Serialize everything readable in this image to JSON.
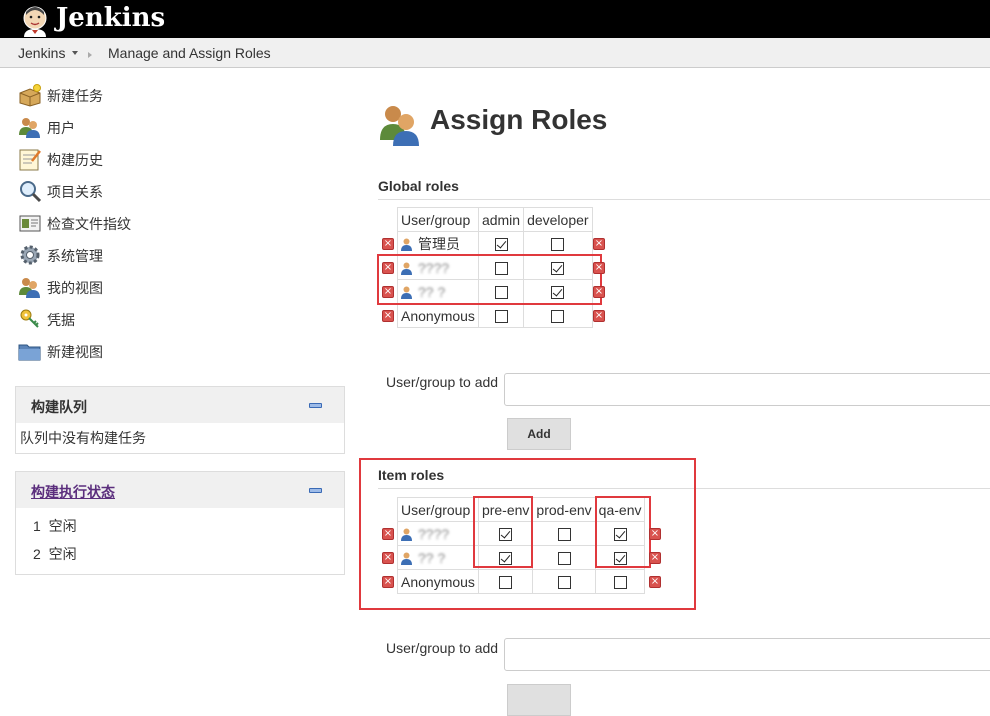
{
  "header": {
    "app_name": "Jenkins",
    "logo_icon": "jenkins-butler-icon"
  },
  "breadcrumb": {
    "root": "Jenkins",
    "current": "Manage and Assign Roles"
  },
  "sidebar": {
    "tasks": [
      {
        "label": "新建任务",
        "icon": "new-package-icon"
      },
      {
        "label": "用户",
        "icon": "users-icon"
      },
      {
        "label": "构建历史",
        "icon": "notepad-icon"
      },
      {
        "label": "项目关系",
        "icon": "magnifier-icon"
      },
      {
        "label": "检查文件指纹",
        "icon": "fingerprint-icon"
      },
      {
        "label": "系统管理",
        "icon": "gear-icon"
      },
      {
        "label": "我的视图",
        "icon": "users-icon"
      },
      {
        "label": "凭据",
        "icon": "keys-icon"
      },
      {
        "label": "新建视图",
        "icon": "folder-icon"
      }
    ],
    "build_queue": {
      "title": "构建队列",
      "empty_text": "队列中没有构建任务"
    },
    "executors": {
      "title": "构建执行状态",
      "items": [
        {
          "num": "1",
          "status": "空闲"
        },
        {
          "num": "2",
          "status": "空闲"
        }
      ]
    }
  },
  "main": {
    "title": "Assign Roles",
    "global": {
      "title": "Global roles",
      "header": [
        "User/group",
        "admin",
        "developer"
      ],
      "rows": [
        {
          "name": "管理员",
          "user_icon": true,
          "blurred": false,
          "checks": [
            true,
            false
          ]
        },
        {
          "name": "????",
          "user_icon": true,
          "blurred": true,
          "checks": [
            false,
            true
          ]
        },
        {
          "name": "?? ?",
          "user_icon": true,
          "blurred": true,
          "checks": [
            false,
            true
          ]
        },
        {
          "name": "Anonymous",
          "user_icon": false,
          "blurred": false,
          "checks": [
            false,
            false
          ]
        }
      ]
    },
    "item": {
      "title": "Item roles",
      "header": [
        "User/group",
        "pre-env",
        "prod-env",
        "qa-env"
      ],
      "rows": [
        {
          "name": "????",
          "user_icon": true,
          "blurred": true,
          "checks": [
            true,
            false,
            true
          ]
        },
        {
          "name": "?? ?",
          "user_icon": true,
          "blurred": true,
          "checks": [
            true,
            false,
            true
          ]
        },
        {
          "name": "Anonymous",
          "user_icon": false,
          "blurred": false,
          "checks": [
            false,
            false,
            false
          ]
        }
      ]
    },
    "add_label": "User/group to add",
    "add_button": "Add",
    "colors": {
      "highlight": "#e0393e",
      "delete": "#d9534f"
    }
  }
}
